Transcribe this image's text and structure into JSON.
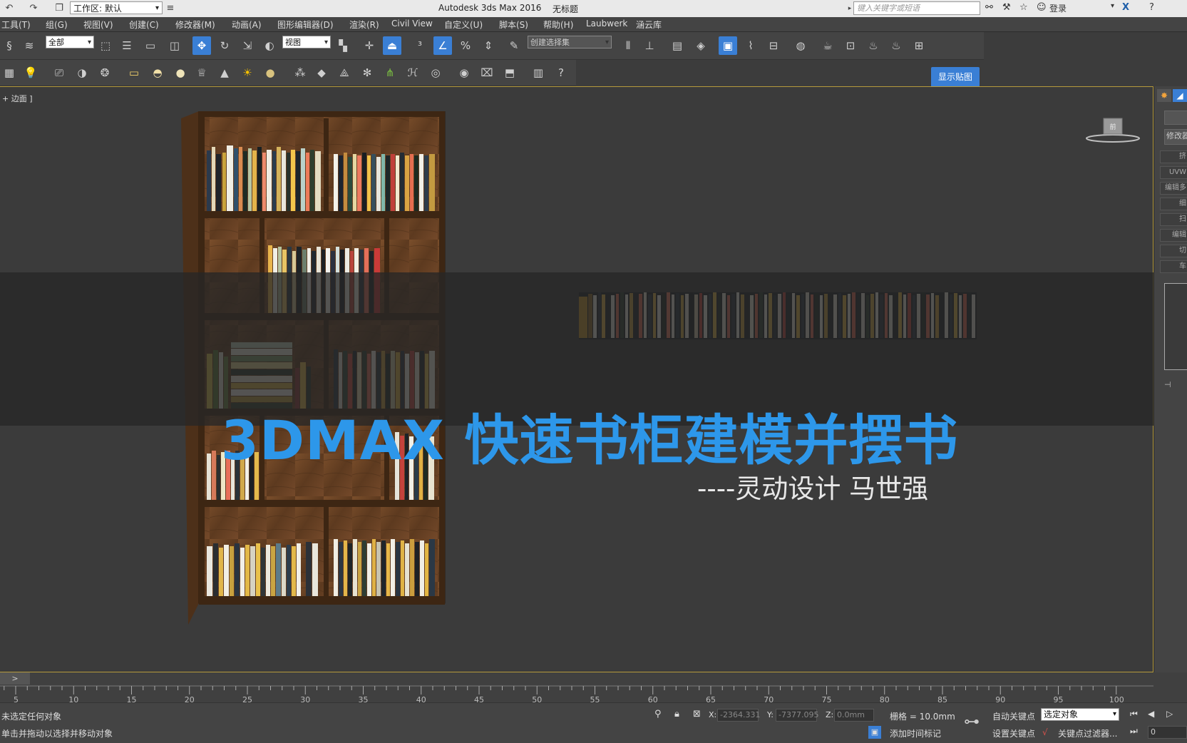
{
  "titlebar": {
    "workspace": "工作区: 默认",
    "app_title": "Autodesk 3ds Max 2016",
    "doc_title": "无标题",
    "search_placeholder": "键入关键字或短语",
    "login": "登录"
  },
  "menu": [
    "工具(T)",
    "组(G)",
    "视图(V)",
    "创建(C)",
    "修改器(M)",
    "动画(A)",
    "图形编辑器(D)",
    "渲染(R)",
    "Civil View",
    "自定义(U)",
    "脚本(S)",
    "帮助(H)",
    "Laubwerk",
    "涵云库"
  ],
  "toolbar": {
    "filter_combo": "全部",
    "view_combo": "视图",
    "selection_set": "创建选择集",
    "show_map": "显示贴图"
  },
  "viewport": {
    "label": "+ 边面 ]",
    "viewcube_label": "前"
  },
  "overlay": {
    "title": "3DMAX 快速书柜建模并摆书",
    "subtitle": "----灵动设计 马世强"
  },
  "right_panel": {
    "modifier_list": "修改器",
    "buttons": [
      "挤",
      "UVW",
      "编辑多",
      "细",
      "扫",
      "编辑",
      "切",
      "车"
    ]
  },
  "timeline": {
    "slider": ">",
    "ticks": [
      5,
      10,
      15,
      20,
      25,
      30,
      35,
      40,
      45,
      50,
      55,
      60,
      65,
      70,
      75,
      80,
      85,
      90,
      95,
      100
    ]
  },
  "status": {
    "line1": "未选定任何对象",
    "line2": "单击并拖动以选择并移动对象",
    "x_value": "-2364.331",
    "y_value": "-7377.095",
    "z_value": "0.0mm",
    "grid": "栅格 = 10.0mm",
    "add_time_tag": "添加时间标记",
    "auto_key": "自动关键点",
    "set_key": "设置关键点",
    "selected_object": "选定对象",
    "key_filter": "关键点过滤器...",
    "frame": "0"
  },
  "colors": {
    "accent": "#3a7fd5",
    "title_blue": "#2d97ea",
    "viewport_border": "#b59a3c",
    "wood": "#6b4424"
  }
}
